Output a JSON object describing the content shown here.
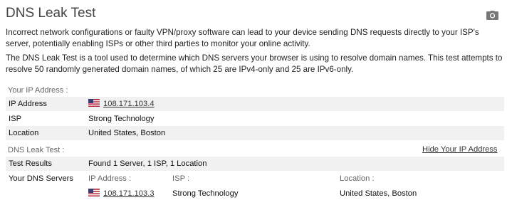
{
  "title": "DNS Leak Test",
  "icons": {
    "screenshot": "camera-icon",
    "flag": "us-flag-icon"
  },
  "intro": {
    "paragraph1": "Incorrect network configurations or faulty VPN/proxy software can lead to your device sending DNS requests directly to your ISP's server, potentially enabling ISPs or other third parties to monitor your online activity.",
    "paragraph2": "The DNS Leak Test is a tool used to determine which DNS servers your browser is using to resolve domain names. This test attempts to resolve 50 randomly generated domain names, of which 25 are IPv4-only and 25 are IPv6-only."
  },
  "ip_section": {
    "label": "Your IP Address :",
    "ip_key": "IP Address",
    "ip_value": "108.171.103.4",
    "isp_key": "ISP",
    "isp_value": "Strong Technology",
    "location_key": "Location",
    "location_value": "United States, Boston"
  },
  "dns_section": {
    "label": "DNS Leak Test :",
    "hide_link": "Hide Your IP Address",
    "results_key": "Test Results",
    "results_value": "Found 1 Server, 1 ISP, 1 Location",
    "servers_key": "Your DNS Servers",
    "col_ip": "IP Address :",
    "col_isp": "ISP :",
    "col_location": "Location :",
    "servers": [
      {
        "ip": "108.171.103.3",
        "isp": "Strong Technology",
        "location": "United States, Boston"
      }
    ]
  }
}
